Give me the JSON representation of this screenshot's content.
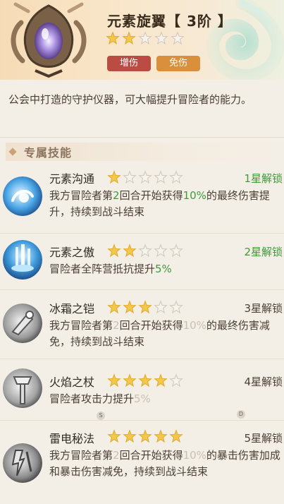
{
  "header": {
    "title": "元素旋翼【 3阶 】",
    "stars_filled": 2,
    "stars_total": 5,
    "tags": [
      "增伤",
      "免伤"
    ],
    "colors": {
      "tag_red": "#bb4c44",
      "tag_orange": "#d98f3c",
      "star_gold": "#f2c84b"
    },
    "icon": "rotor-relic-icon"
  },
  "description": "公会中打造的守护仪器，可大幅提升冒险者的能力。",
  "section": {
    "title": "专属技能"
  },
  "skills": [
    {
      "name": "元素沟通",
      "stars_filled": 1,
      "unlock": "1星解锁",
      "unlock_active": true,
      "icon": "element-orb-icon",
      "desc_a": "我方冒险者第",
      "desc_num": "2",
      "desc_b": "回合开始获得",
      "desc_pct": "10%",
      "desc_c": "的最终伤害提升，持续到战斗结束"
    },
    {
      "name": "元素之傲",
      "stars_filled": 2,
      "unlock": "2星解锁",
      "unlock_active": true,
      "icon": "element-fountain-icon",
      "desc_a": "冒险者全阵营抵抗提升",
      "desc_pct": "5%"
    },
    {
      "name": "冰霜之铠",
      "stars_filled": 3,
      "unlock": "3星解锁",
      "unlock_active": false,
      "icon": "frost-armor-icon",
      "desc_a": "我方冒险者第",
      "desc_num": "2",
      "desc_b": "回合开始获得",
      "desc_pct": "10%",
      "desc_c": "的最终伤害减免，持续到战斗结束"
    },
    {
      "name": "火焰之杖",
      "stars_filled": 4,
      "unlock": "4星解锁",
      "unlock_active": false,
      "icon": "flame-staff-icon",
      "desc_a": "冒险者攻击力提升",
      "desc_pct": "5%"
    },
    {
      "name": "雷电秘法",
      "stars_filled": 5,
      "unlock": "5星解锁",
      "unlock_active": false,
      "icon": "thunder-arcana-icon",
      "desc_a": "我方冒险者第",
      "desc_num": "2",
      "desc_b": "回合开始获得",
      "desc_pct": "10%",
      "desc_c": "的暴击伤害加成和暴击伤害减免，持续到战斗结束"
    }
  ],
  "badges": [
    "S",
    "D"
  ]
}
